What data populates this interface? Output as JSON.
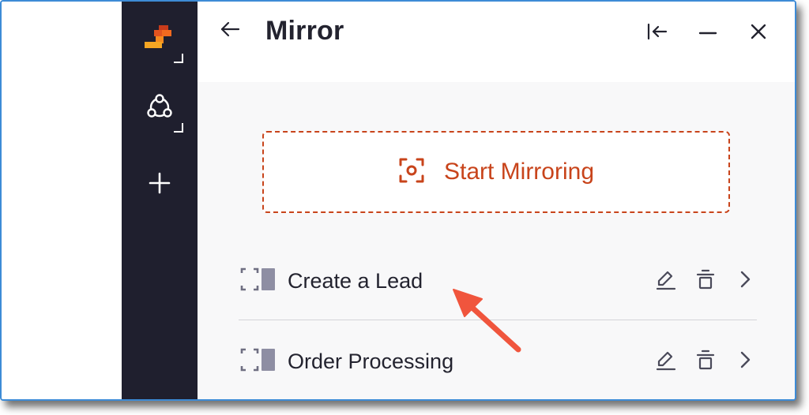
{
  "panel": {
    "title": "Mirror"
  },
  "header_icons": {
    "back": "arrow-left-icon",
    "collapse": "collapse-left-icon",
    "minimize": "minimize-icon",
    "close": "close-icon"
  },
  "sidebar": {
    "items": [
      {
        "icon": "brand-logo-icon"
      },
      {
        "icon": "share-nodes-icon"
      },
      {
        "icon": "plus-icon"
      }
    ]
  },
  "start": {
    "label": "Start Mirroring",
    "icon": "capture-icon"
  },
  "mirrors": [
    {
      "name": "Create a Lead",
      "icons": [
        "bracket-app-icon",
        "edit-icon",
        "trash-icon",
        "chevron-right-icon"
      ]
    },
    {
      "name": "Order Processing",
      "icons": [
        "bracket-app-icon",
        "edit-icon",
        "trash-icon",
        "chevron-right-icon"
      ]
    }
  ],
  "colors": {
    "sidebar": "#1f1f2e",
    "accent": "#c8441b",
    "annotation_arrow": "#f0553d",
    "frame_border": "#3d8bd6"
  }
}
